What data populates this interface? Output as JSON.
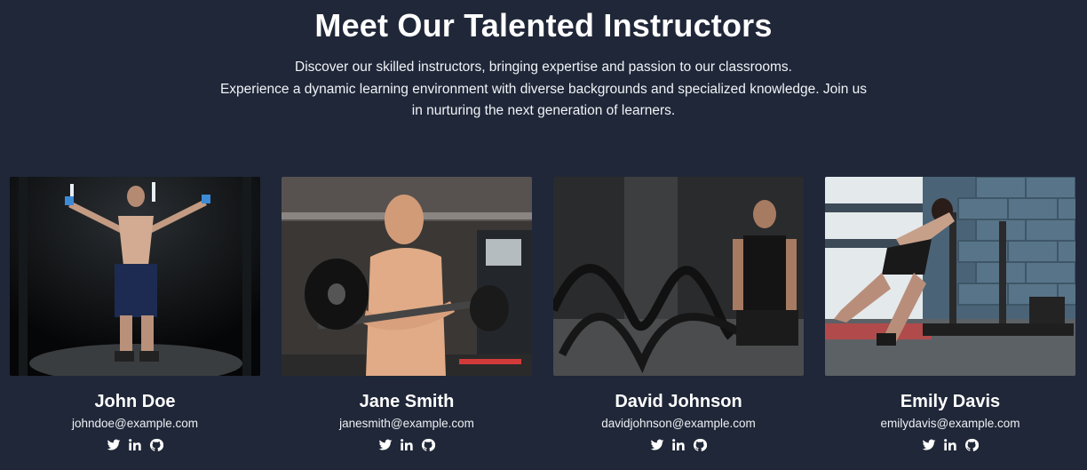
{
  "header": {
    "title": "Meet Our Talented Instructors",
    "description_line1": "Discover our skilled instructors, bringing expertise and passion to our classrooms.",
    "description_line2": "Experience a dynamic learning environment with diverse backgrounds and specialized knowledge. Join us",
    "description_line3": "in nurturing the next generation of learners."
  },
  "instructors": [
    {
      "name": "John Doe",
      "email": "johndoe@example.com",
      "photo": "man-flexing-cable-machine"
    },
    {
      "name": "Jane Smith",
      "email": "janesmith@example.com",
      "photo": "man-lifting-barbell"
    },
    {
      "name": "David Johnson",
      "email": "davidjohnson@example.com",
      "photo": "man-battle-ropes"
    },
    {
      "name": "Emily Davis",
      "email": "emilydavis@example.com",
      "photo": "woman-pushing-sled"
    }
  ],
  "social_icons": [
    "twitter-icon",
    "linkedin-icon",
    "github-icon"
  ],
  "colors": {
    "background": "#1f2738",
    "text": "#ffffff"
  }
}
